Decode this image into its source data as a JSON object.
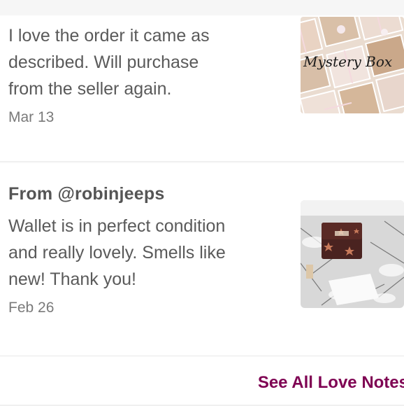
{
  "notes": [
    {
      "from": "",
      "body_lines": [
        "I love the order it came as",
        "described. Will purchase",
        "from the seller again."
      ],
      "date": "Mar 13",
      "image": {
        "caption": "Mystery Box",
        "kind": "gift-boxes-photo"
      }
    },
    {
      "from": "From @robinjeeps",
      "body_lines": [
        "Wallet is in perfect condition",
        "and really lovely. Smells like",
        "new! Thank you!"
      ],
      "date": "Feb 26",
      "image": {
        "kind": "wallet-on-fur-photo"
      }
    }
  ],
  "footer": {
    "see_all_label": "See All Love Notes"
  },
  "colors": {
    "link": "#7f0353",
    "text": "#555555"
  }
}
